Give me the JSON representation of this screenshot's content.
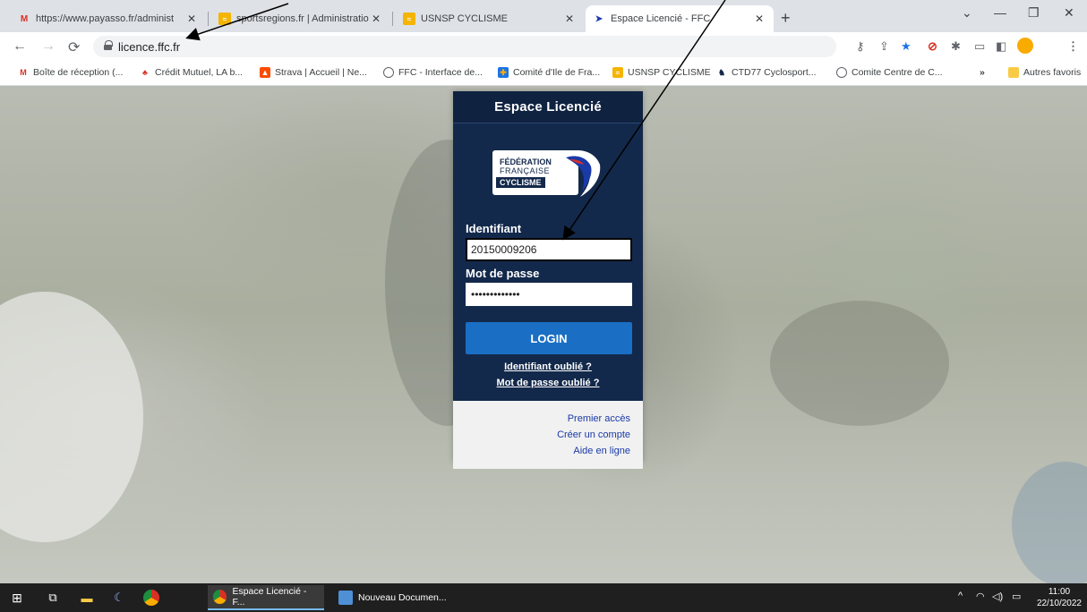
{
  "tabs": [
    {
      "title": "https://www.payasso.fr/administ",
      "active": false
    },
    {
      "title": "sportsregions.fr | Administration",
      "active": false
    },
    {
      "title": "USNSP CYCLISME",
      "active": false
    },
    {
      "title": "Espace Licencié - FFC",
      "active": true
    }
  ],
  "address_bar": {
    "url": "licence.ffc.fr"
  },
  "bookmarks": [
    "Boîte de réception (...",
    "Crédit Mutuel, LA b...",
    "Strava | Accueil | Ne...",
    "FFC - Interface de...",
    "Comité d'Ile de Fra...",
    "USNSP CYCLISME",
    "CTD77 Cyclosport...",
    "Comite Centre de C..."
  ],
  "bookmarks_overflow": "»",
  "other_bookmarks": "Autres favoris",
  "login_panel": {
    "title": "Espace Licencié",
    "logo": {
      "line1": "FÉDÉRATION",
      "line2": "FRANÇAISE",
      "line3": "CYCLISME"
    },
    "username_label": "Identifiant",
    "username_value": "20150009206",
    "password_label": "Mot de passe",
    "password_value": "•••••••••••••",
    "login_button": "LOGIN",
    "forgot_username": "Identifiant oublié ?",
    "forgot_password": "Mot de passe oublié ?",
    "footer_links": [
      "Premier accès",
      "Créer un compte",
      "Aide en ligne"
    ]
  },
  "taskbar": {
    "apps": [
      {
        "label": "Espace Licencié - F...",
        "active": true
      },
      {
        "label": "Nouveau Documen...",
        "active": false
      }
    ],
    "time": "11:00",
    "date": "22/10/2022"
  },
  "colors": {
    "panel_bg": "#13294b",
    "login_button": "#1a6fc4",
    "taskbar": "#1f1f1f",
    "tab_strip": "#dee1e6"
  }
}
